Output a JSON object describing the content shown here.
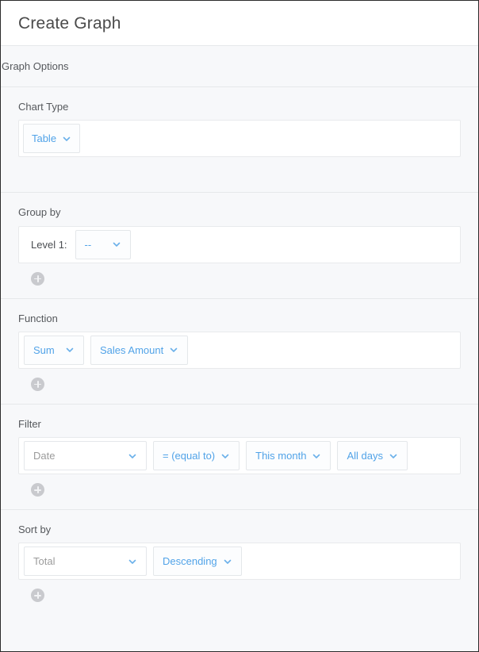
{
  "header": {
    "title": "Create Graph"
  },
  "options_strip": {
    "label": "Graph Options"
  },
  "sections": {
    "chart_type": {
      "label": "Chart Type",
      "value": "Table"
    },
    "group_by": {
      "label": "Group by",
      "level_label": "Level 1:",
      "level_value": "--"
    },
    "function": {
      "label": "Function",
      "aggregate": "Sum",
      "field": "Sales Amount"
    },
    "filter": {
      "label": "Filter",
      "field": "Date",
      "operator": "= (equal to)",
      "period": "This month",
      "days": "All days"
    },
    "sort_by": {
      "label": "Sort by",
      "field": "Total",
      "direction": "Descending"
    }
  },
  "icons": {
    "chevron": "chevron-down-icon",
    "add": "plus-icon"
  },
  "colors": {
    "accent_blue": "#51a3e8",
    "page_bg": "#f7f8fa",
    "panel_bg": "#ffffff",
    "border": "#e6e8ea",
    "text_dark": "#4a4a4a",
    "text_muted": "#9b9b9b",
    "add_button": "#c9cace"
  }
}
